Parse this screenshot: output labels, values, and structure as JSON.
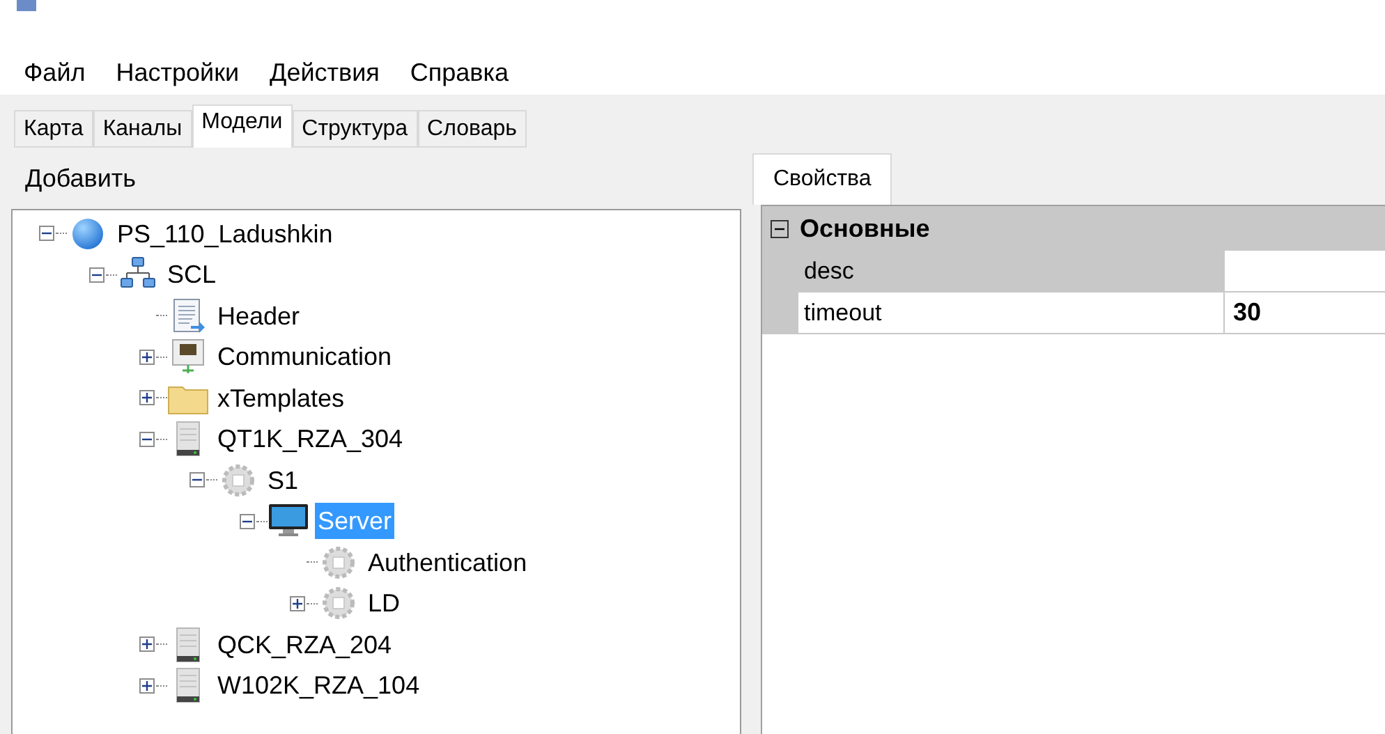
{
  "menu": [
    "Файл",
    "Настройки",
    "Действия",
    "Справка"
  ],
  "tabs": [
    {
      "label": "Карта",
      "selected": false
    },
    {
      "label": "Каналы",
      "selected": false
    },
    {
      "label": "Модели",
      "selected": true
    },
    {
      "label": "Структура",
      "selected": false
    },
    {
      "label": "Словарь",
      "selected": false
    }
  ],
  "toolbar": {
    "add": "Добавить"
  },
  "tree": [
    {
      "label": "PS_110_Ladushkin",
      "kind": "globe",
      "expanded": true,
      "selected": false,
      "children": [
        {
          "label": "SCL",
          "kind": "network",
          "expanded": true,
          "selected": false,
          "children": [
            {
              "label": "Header",
              "kind": "document",
              "selected": false
            },
            {
              "label": "Communication",
              "kind": "nic",
              "expanded": false,
              "selected": false
            },
            {
              "label": "xTemplates",
              "kind": "folder",
              "expanded": false,
              "selected": false
            },
            {
              "label": "QT1K_RZA_304",
              "kind": "server",
              "expanded": true,
              "selected": false,
              "children": [
                {
                  "label": "S1",
                  "kind": "gear",
                  "expanded": true,
                  "selected": false,
                  "children": [
                    {
                      "label": "Server",
                      "kind": "monitor",
                      "expanded": true,
                      "selected": true,
                      "children": [
                        {
                          "label": "Authentication",
                          "kind": "gear",
                          "selected": false
                        },
                        {
                          "label": "LD",
                          "kind": "gear",
                          "expanded": false,
                          "selected": false
                        }
                      ]
                    }
                  ]
                }
              ]
            },
            {
              "label": "QCK_RZA_204",
              "kind": "server",
              "expanded": false,
              "selected": false
            },
            {
              "label": "W102K_RZA_104",
              "kind": "server",
              "expanded": false,
              "selected": false
            }
          ]
        }
      ]
    }
  ],
  "properties": {
    "tab": "Свойства",
    "category": {
      "label": "Основные",
      "expanded": true
    },
    "rows": [
      {
        "name": "desc",
        "value": "",
        "selected": false
      },
      {
        "name": "timeout",
        "value": "30",
        "selected": true
      }
    ]
  }
}
